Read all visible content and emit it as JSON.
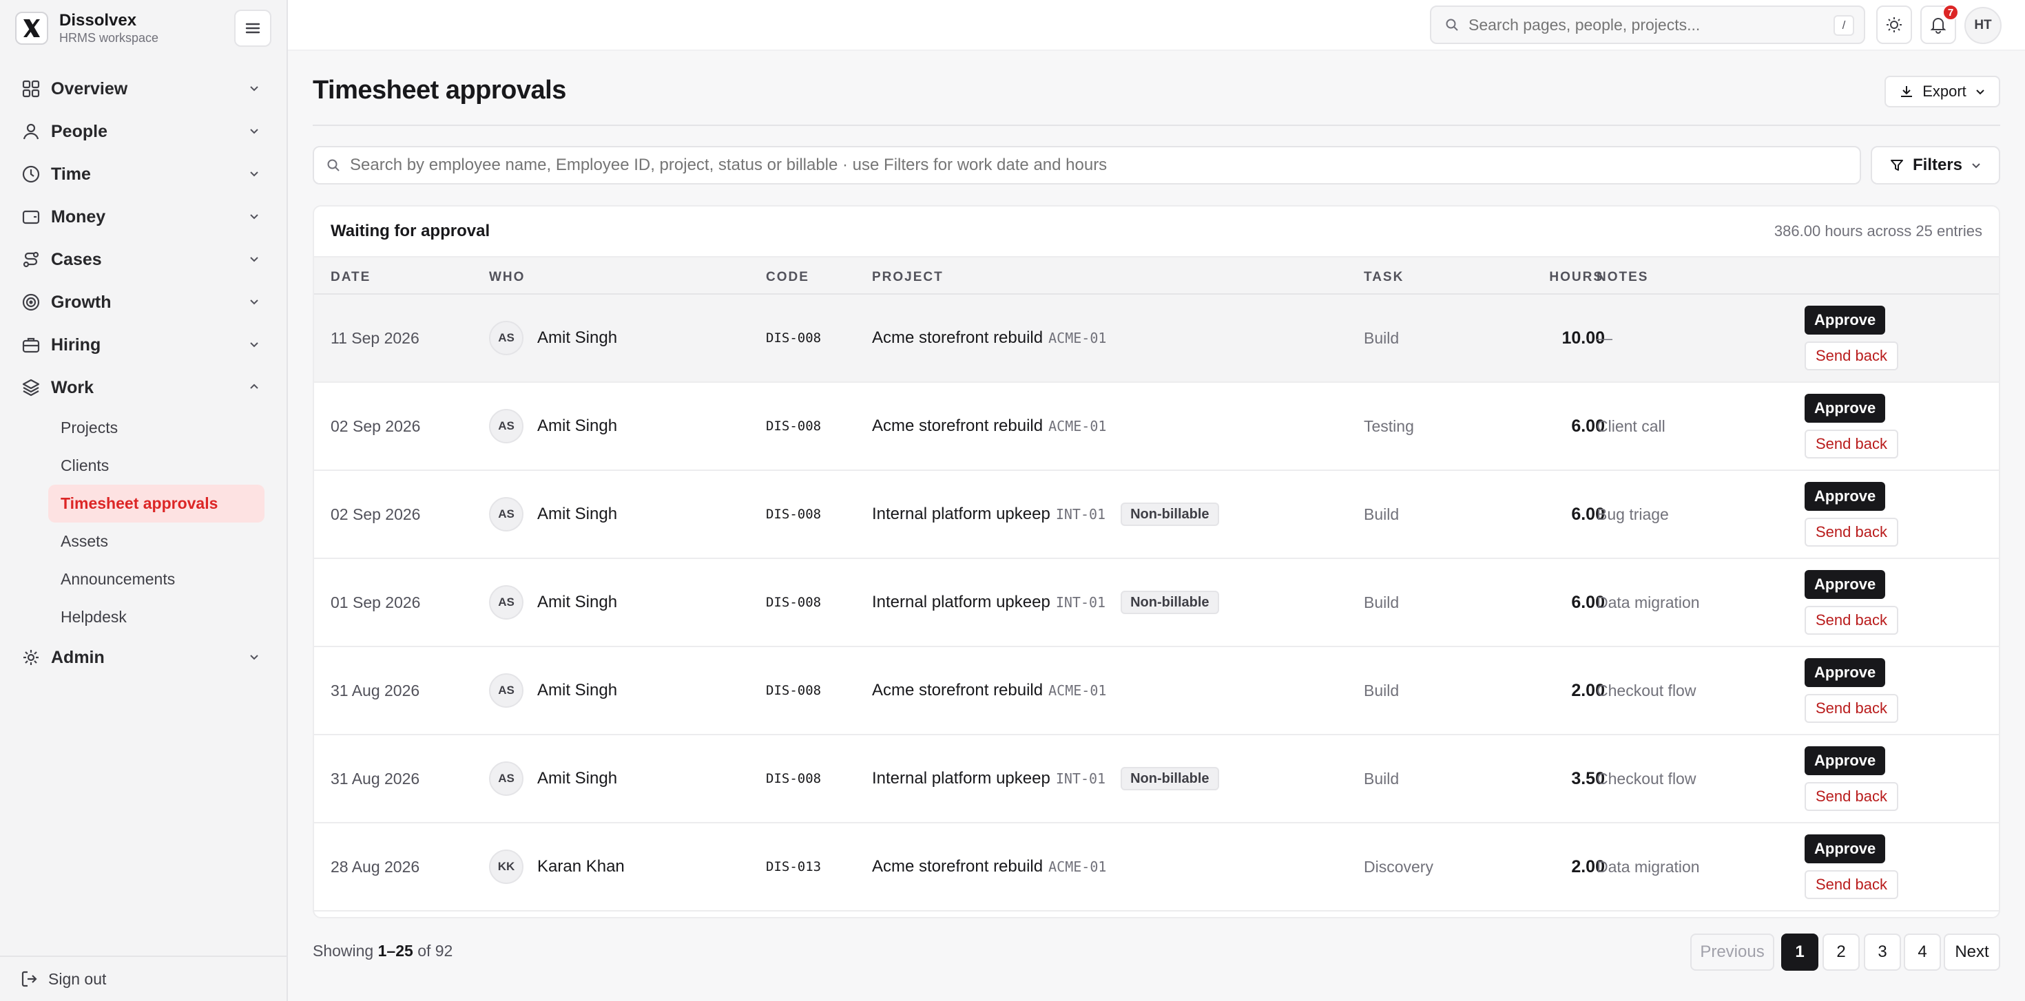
{
  "brand": {
    "name": "Dissolvex",
    "subtitle": "HRMS workspace"
  },
  "sidebar": {
    "items": [
      {
        "label": "Overview",
        "icon": "grid-icon"
      },
      {
        "label": "People",
        "icon": "user-icon"
      },
      {
        "label": "Time",
        "icon": "clock-icon"
      },
      {
        "label": "Money",
        "icon": "wallet-icon"
      },
      {
        "label": "Cases",
        "icon": "route-icon"
      },
      {
        "label": "Growth",
        "icon": "target-icon"
      },
      {
        "label": "Hiring",
        "icon": "briefcase-icon"
      },
      {
        "label": "Work",
        "icon": "layers-icon",
        "expanded": true
      },
      {
        "label": "Admin",
        "icon": "gear-icon"
      }
    ],
    "work_subitems": [
      {
        "label": "Projects"
      },
      {
        "label": "Clients"
      },
      {
        "label": "Timesheet approvals",
        "active": true
      },
      {
        "label": "Assets"
      },
      {
        "label": "Announcements"
      },
      {
        "label": "Helpdesk"
      }
    ],
    "sign_out": "Sign out"
  },
  "topbar": {
    "search_placeholder": "Search pages, people, projects...",
    "search_shortcut": "/",
    "notifications_count": "7",
    "user_initials": "HT"
  },
  "page": {
    "title": "Timesheet approvals",
    "export_label": "Export",
    "search_placeholder": "Search by employee name, Employee ID, project, status or billable · use Filters for work date and hours",
    "filters_label": "Filters"
  },
  "table": {
    "title": "Waiting for approval",
    "summary": "386.00 hours across 25 entries",
    "columns": {
      "date": "DATE",
      "who": "WHO",
      "code": "CODE",
      "project": "PROJECT",
      "task": "TASK",
      "hours": "HOURS",
      "notes": "NOTES"
    },
    "approve_label": "Approve",
    "send_back_label": "Send back",
    "rows": [
      {
        "date": "11 Sep 2026",
        "initials": "AS",
        "name": "Amit Singh",
        "code": "DIS-008",
        "project": "Acme storefront rebuild",
        "project_code": "ACME-01",
        "tag": "",
        "task": "Build",
        "hours": "10.00",
        "notes": "—"
      },
      {
        "date": "02 Sep 2026",
        "initials": "AS",
        "name": "Amit Singh",
        "code": "DIS-008",
        "project": "Acme storefront rebuild",
        "project_code": "ACME-01",
        "tag": "",
        "task": "Testing",
        "hours": "6.00",
        "notes": "Client call"
      },
      {
        "date": "02 Sep 2026",
        "initials": "AS",
        "name": "Amit Singh",
        "code": "DIS-008",
        "project": "Internal platform upkeep",
        "project_code": "INT-01",
        "tag": "Non-billable",
        "task": "Build",
        "hours": "6.00",
        "notes": "Bug triage"
      },
      {
        "date": "01 Sep 2026",
        "initials": "AS",
        "name": "Amit Singh",
        "code": "DIS-008",
        "project": "Internal platform upkeep",
        "project_code": "INT-01",
        "tag": "Non-billable",
        "task": "Build",
        "hours": "6.00",
        "notes": "Data migration"
      },
      {
        "date": "31 Aug 2026",
        "initials": "AS",
        "name": "Amit Singh",
        "code": "DIS-008",
        "project": "Acme storefront rebuild",
        "project_code": "ACME-01",
        "tag": "",
        "task": "Build",
        "hours": "2.00",
        "notes": "Checkout flow"
      },
      {
        "date": "31 Aug 2026",
        "initials": "AS",
        "name": "Amit Singh",
        "code": "DIS-008",
        "project": "Internal platform upkeep",
        "project_code": "INT-01",
        "tag": "Non-billable",
        "task": "Build",
        "hours": "3.50",
        "notes": "Checkout flow"
      },
      {
        "date": "28 Aug 2026",
        "initials": "KK",
        "name": "Karan Khan",
        "code": "DIS-013",
        "project": "Acme storefront rebuild",
        "project_code": "ACME-01",
        "tag": "",
        "task": "Discovery",
        "hours": "2.00",
        "notes": "Data migration"
      }
    ]
  },
  "pagination": {
    "showing_prefix": "Showing",
    "showing_range": "1–25",
    "showing_of": "of 92",
    "previous": "Previous",
    "pages": [
      "1",
      "2",
      "3",
      "4"
    ],
    "current": "1",
    "next": "Next"
  },
  "colors": {
    "accent": "#dc2626",
    "active_bg": "#fde2e2",
    "primary_button": "#18181b"
  }
}
